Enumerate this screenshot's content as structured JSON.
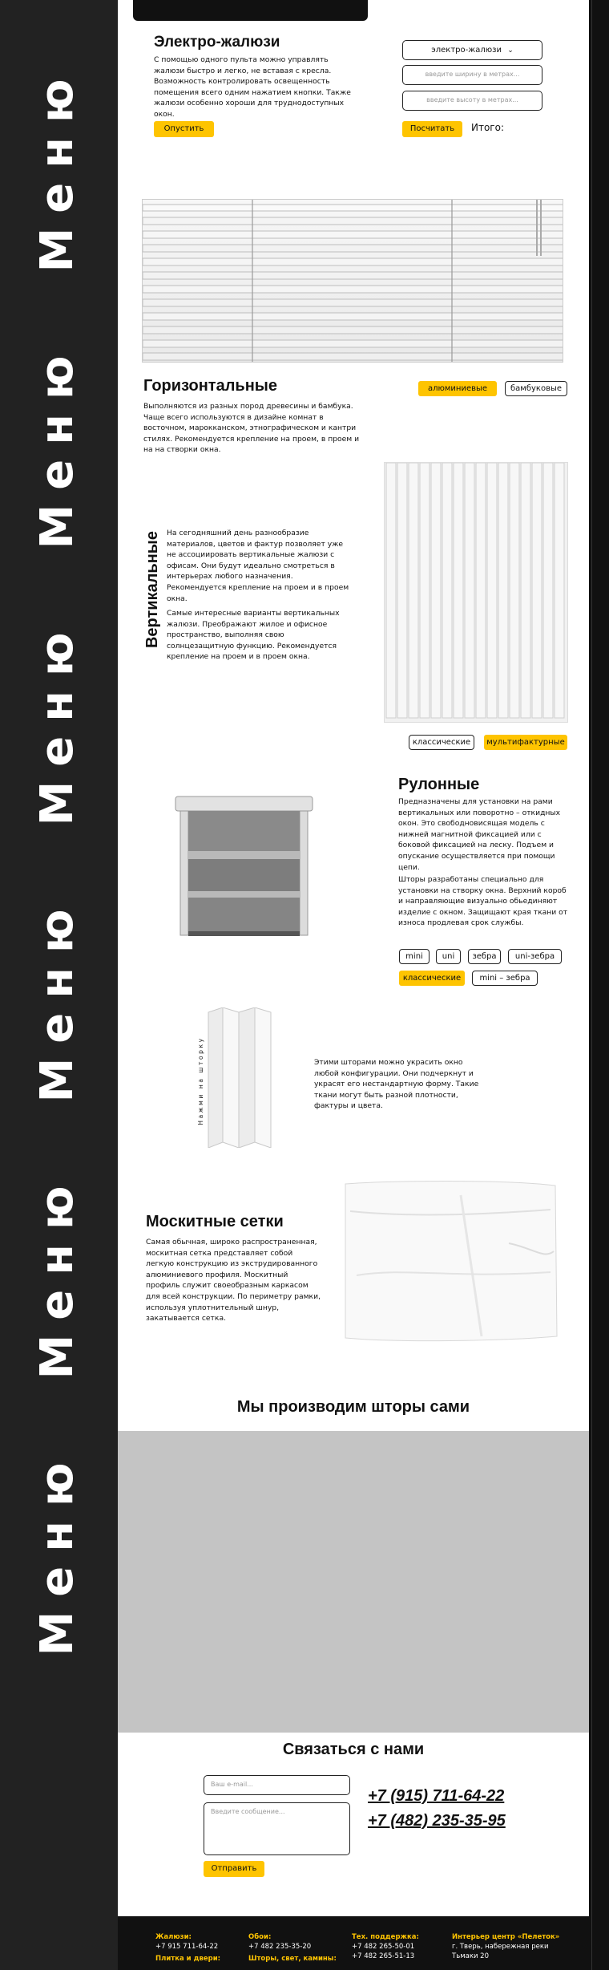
{
  "menu": {
    "label": "Меню"
  },
  "electro": {
    "title": "Электро-жалюзи",
    "text": "С помощью одного пульта можно управлять жалюзи быстро и легко, не вставая с кресла. Возможность контролировать освещенность помещения всего одним нажатием кнопки. Также жалюзи особенно хороши для труднодоступных окон.",
    "start_button": "Опустить",
    "type_select": "электро-жалюзи",
    "width_placeholder": "введите ширину в метрах...",
    "height_placeholder": "введите высоту в метрах...",
    "calc_button": "Посчитать",
    "total_label": "Итого:"
  },
  "horizontal": {
    "title": "Горизонтальные",
    "text": "Выполняются из разных пород древесины и бамбука. Чаще всего используются в дизайне комнат в восточном, марокканском, этнографическом и кантри стилях. Рекомендуется крепление на проем, в проем и на на створки окна.",
    "buttons": [
      "алюминиевые",
      "бамбуковые"
    ]
  },
  "vertical": {
    "title": "Вертикальные",
    "text1": "На сегодняшний день разнообразие материалов, цветов и фактур позволяет уже не ассоциировать вертикальные жалюзи с офисам. Они будут идеально смотреться в интерьерах любого назначения. Рекомендуется крепление на проем и в проем окна.",
    "text2": "Самые интересные варианты вертикальных жалюзи. Преображают жилое и офисное пространство, выполняя свою солнцезащитную функцию. Рекомендуется крепление на проем и в проем окна.",
    "buttons": [
      "классические",
      "мультифактурные"
    ]
  },
  "roller": {
    "title": "Рулонные",
    "text1": "Предназначены для установки на рами вертикальных или поворотно – откидных окон. Это свободновисящая модель с нижней магнитной фиксацией или с боковой фиксацией на леску. Подъем и опускание осуществляется при помощи цепи.",
    "text2": "Шторы разработаны специально для установки на створку окна. Верхний короб и направляющие визуально обьединяют изделие с окном. Защищают края ткани от износа продлевая срок службы.",
    "buttons": [
      "mini",
      "uni",
      "зебра",
      "uni-зебра",
      "классические",
      "mini – зебра"
    ]
  },
  "pleated": {
    "side_label": "Нажми на шторку",
    "text": "Этими шторами можно украсить окно любой конфигурации. Они подчеркнут и украсят его нестандартную форму. Такие ткани могут быть разной плотности, фактуры и цвета."
  },
  "mosquito": {
    "title": "Москитные сетки",
    "text": "Самая обычная, широко распространенная, москитная сетка представляет собой легкую конструкцию из экструдированного алюминиевого профиля. Москитный профиль служит своеобразным каркасом для всей конструкции. По периметру рамки, используя уплотнительный шнур, закатывается сетка."
  },
  "production": {
    "title": "Мы производим шторы сами"
  },
  "contact": {
    "title": "Связаться с нами",
    "email_placeholder": "Ваш e-mail...",
    "message_placeholder": "Введите сообщение...",
    "send_button": "Отправить",
    "phones": [
      "+7 (915) 711-64-22",
      "+7 (482) 235-35-95"
    ]
  },
  "footer": {
    "col1_head": "Жалюзи:",
    "col1_line": "+7 915 711-64-22",
    "col1_head2": "Плитка и двери:",
    "col2_head": "Обои:",
    "col2_line": "+7 482 235-35-20",
    "col2_head2": "Шторы, свет, камины:",
    "col3_head": "Тех. поддержка:",
    "col3_line1": "+7 482 265-50-01",
    "col3_line2": "+7 482 265-51-13",
    "col4_head": "Интерьер центр «Пелеток»",
    "col4_line1": "г. Тверь, набережная реки",
    "col4_line2": "Тьмаки 20"
  },
  "colors": {
    "accent": "#fec401",
    "dark": "#222222",
    "placeholder_grey": "#c4c4c4"
  }
}
